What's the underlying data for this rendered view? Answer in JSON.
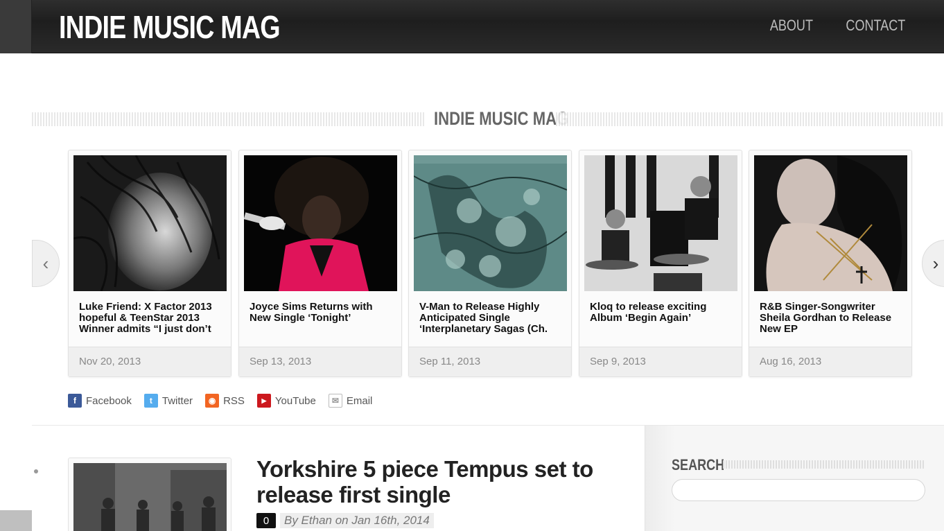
{
  "header": {
    "logo": "INDIE MUSIC MAG",
    "nav": [
      "ABOUT",
      "CONTACT"
    ]
  },
  "section": {
    "title": "INDIE MUSIC MAG"
  },
  "carousel": {
    "cards": [
      {
        "title": "Luke Friend: X Factor 2013 hopeful & TeenStar 2013 Winner admits “I just don’t",
        "date": "Nov 20, 2013"
      },
      {
        "title": "Joyce Sims Returns with New Single ‘Tonight’",
        "date": "Sep 13, 2013"
      },
      {
        "title": "V-Man to Release Highly Anticipated Single ‘Interplanetary Sagas (Ch.",
        "date": "Sep 11, 2013"
      },
      {
        "title": "Kloq to release exciting Album ‘Begin Again’",
        "date": "Sep 9, 2013"
      },
      {
        "title": "R&B Singer-Songwriter Sheila Gordhan to Release New EP",
        "date": "Aug 16, 2013"
      }
    ]
  },
  "social": [
    {
      "label": "Facebook",
      "icon": "facebook-icon",
      "color": "#3b5998"
    },
    {
      "label": "Twitter",
      "icon": "twitter-icon",
      "color": "#55acee"
    },
    {
      "label": "RSS",
      "icon": "rss-icon",
      "color": "#f26522"
    },
    {
      "label": "YouTube",
      "icon": "youtube-icon",
      "color": "#cc181e"
    },
    {
      "label": "Email",
      "icon": "email-icon",
      "color": "#9a9a9a"
    }
  ],
  "post": {
    "title": "Yorkshire 5 piece Tempus set to release first single",
    "comments": "0",
    "meta": "By Ethan on Jan 16th, 2014"
  },
  "sidebar": {
    "search_title": "SEARCH",
    "search_placeholder": ""
  }
}
